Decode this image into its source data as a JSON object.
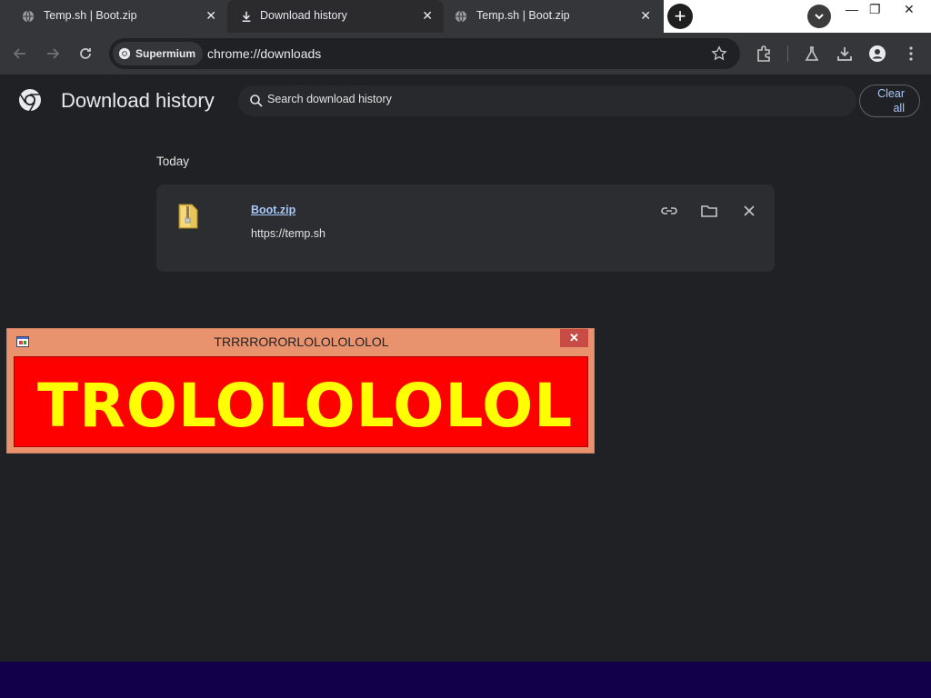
{
  "tabs": [
    {
      "label": "Temp.sh | Boot.zip",
      "close": "✕"
    },
    {
      "label": "Download history",
      "close": "✕"
    },
    {
      "label": "Temp.sh | Boot.zip",
      "close": "✕"
    }
  ],
  "newtab_label": "+",
  "window_controls": {
    "minimize": "—",
    "restore": "❐",
    "close": "✕"
  },
  "toolbar": {
    "chip_label": "Supermium",
    "url": "chrome://downloads"
  },
  "page": {
    "title": "Download history",
    "search_placeholder": "Search download history",
    "clear_label_line1": "Clear",
    "clear_label_line2": "all"
  },
  "downloads": {
    "section_date": "Today",
    "items": [
      {
        "name": "Boot.zip",
        "url": "https://temp.sh"
      }
    ]
  },
  "popup": {
    "title": "TRRRRORORLOLOLOLOLOL",
    "close": "✕",
    "message": "TROLOLOLOLOL",
    "colors": {
      "body": "#ff0000",
      "text": "#ffff00",
      "frame": "#e8926e"
    }
  },
  "colors": {
    "background": "#202124",
    "accent": "#a8c7fa",
    "taskbar": "#13004a"
  }
}
